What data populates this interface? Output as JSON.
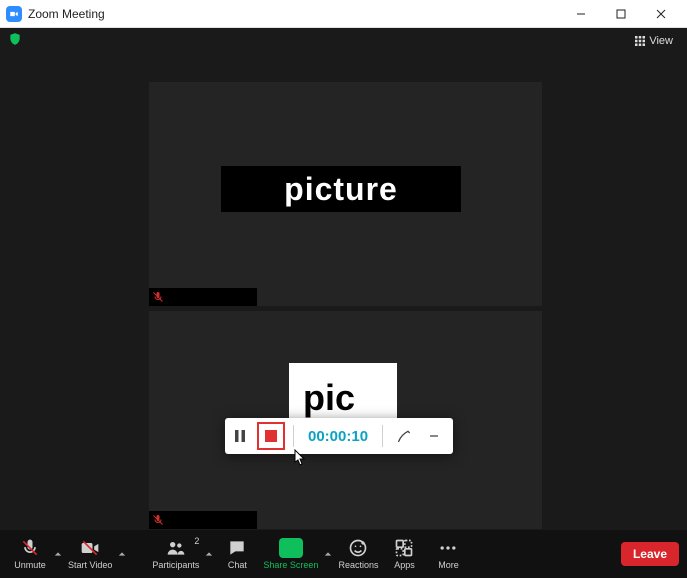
{
  "window": {
    "title": "Zoom Meeting"
  },
  "topbar": {
    "view_label": "View"
  },
  "tiles": {
    "top_content": "picture",
    "bottom_content": "pic"
  },
  "recording": {
    "timer": "00:00:10"
  },
  "controls": {
    "unmute": "Unmute",
    "start_video": "Start Video",
    "participants": "Participants",
    "participants_count": "2",
    "chat": "Chat",
    "share_screen": "Share Screen",
    "reactions": "Reactions",
    "apps": "Apps",
    "more": "More",
    "leave": "Leave"
  }
}
